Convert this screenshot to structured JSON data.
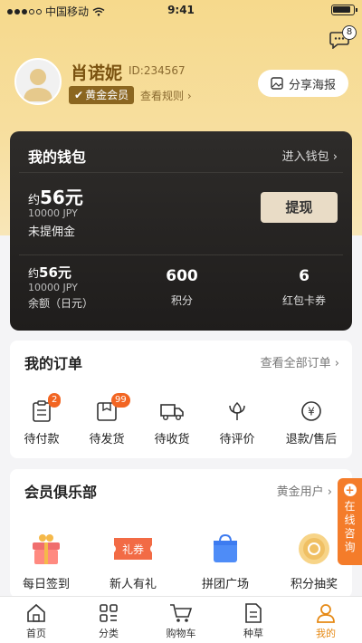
{
  "status_bar": {
    "carrier": "中国移动",
    "time": "9:41"
  },
  "header": {
    "message_count": "8"
  },
  "profile": {
    "name": "肖诺妮",
    "user_id": "ID:234567",
    "member_level": "黄金会员",
    "rules_link": "查看规则",
    "share_button": "分享海报"
  },
  "wallet": {
    "title": "我的钱包",
    "enter_link": "进入钱包",
    "pending": {
      "prefix": "约",
      "amount": "56元",
      "jpy": "10000 JPY",
      "label": "未提佣金"
    },
    "withdraw_button": "提现",
    "balance": {
      "prefix": "约",
      "amount": "56元",
      "jpy": "10000 JPY",
      "label": "余额（日元）"
    },
    "points": {
      "value": "600",
      "label": "积分"
    },
    "coupons": {
      "value": "6",
      "label": "红包卡券"
    }
  },
  "orders": {
    "title": "我的订单",
    "view_all": "查看全部订单",
    "tabs": [
      {
        "label": "待付款",
        "count": "2",
        "icon": "clipboard-icon"
      },
      {
        "label": "待发货",
        "count": "99",
        "icon": "box-icon"
      },
      {
        "label": "待收货",
        "count": "",
        "icon": "truck-icon"
      },
      {
        "label": "待评价",
        "count": "",
        "icon": "flower-icon"
      },
      {
        "label": "退款/售后",
        "count": "",
        "icon": "refund-icon"
      }
    ]
  },
  "club": {
    "title": "会员俱乐部",
    "level": "黄金用户",
    "items": [
      {
        "label": "每日签到",
        "icon": "gift-icon"
      },
      {
        "label": "新人有礼",
        "icon": "coupon-icon",
        "badge_text": "礼券"
      },
      {
        "label": "拼团广场",
        "icon": "bag-icon"
      },
      {
        "label": "积分抽奖",
        "icon": "coin-icon"
      }
    ]
  },
  "consult": {
    "label": "在线咨询"
  },
  "tabbar": [
    {
      "label": "首页",
      "icon": "home-icon"
    },
    {
      "label": "分类",
      "icon": "category-icon"
    },
    {
      "label": "购物车",
      "icon": "cart-icon"
    },
    {
      "label": "种草",
      "icon": "note-icon"
    },
    {
      "label": "我的",
      "icon": "user-icon",
      "active": true
    }
  ],
  "colors": {
    "accent": "#f26522",
    "gold": "#8b6620",
    "active_tab": "#e68a16"
  }
}
